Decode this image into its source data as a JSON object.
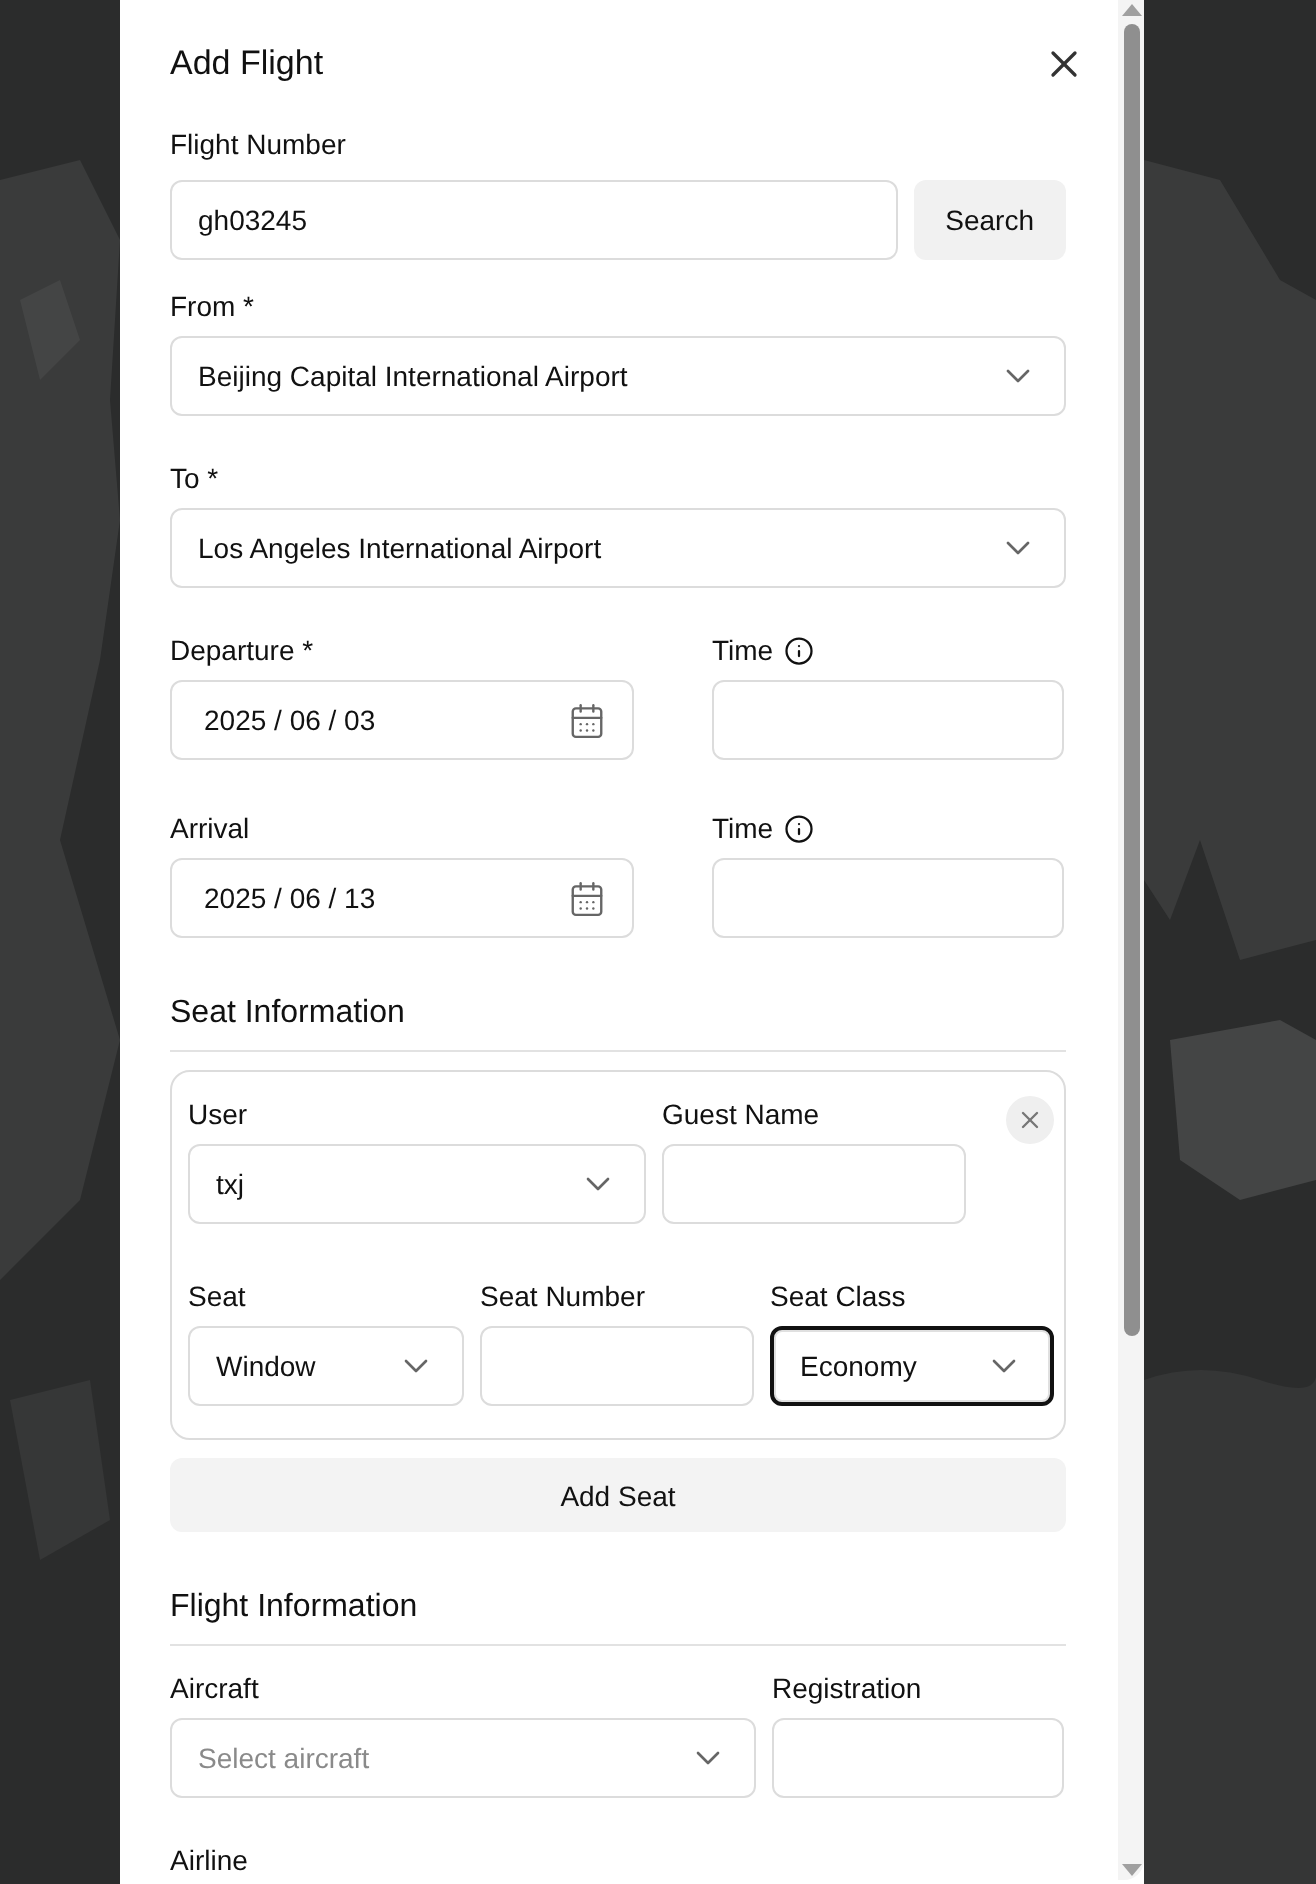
{
  "dialog": {
    "title": "Add Flight"
  },
  "flight_number": {
    "label": "Flight Number",
    "value": "gh03245",
    "button": "Search"
  },
  "from": {
    "label": "From *",
    "value": "Beijing Capital International Airport"
  },
  "to": {
    "label": "To *",
    "value": "Los Angeles International Airport"
  },
  "schedule": [
    {
      "label": "Departure *",
      "date": "2025 / 06 / 03",
      "time_label": "Time"
    },
    {
      "label": "Arrival",
      "date": "2025 / 06 / 13",
      "time_label": "Time"
    }
  ],
  "seat_section": {
    "title": "Seat Information",
    "seats": [
      {
        "user_label": "User",
        "user": "txj",
        "guest_label": "Guest Name",
        "seat_label": "Seat",
        "seat": "Window",
        "seat_number_label": "Seat Number",
        "class_label": "Seat Class",
        "seat_class": "Economy",
        "class_focused": true
      }
    ],
    "add_button": "Add Seat"
  },
  "flight_section": {
    "title": "Flight Information",
    "aircraft_label": "Aircraft",
    "aircraft_placeholder": "Select aircraft",
    "registration_label": "Registration",
    "airline_label": "Airline"
  }
}
